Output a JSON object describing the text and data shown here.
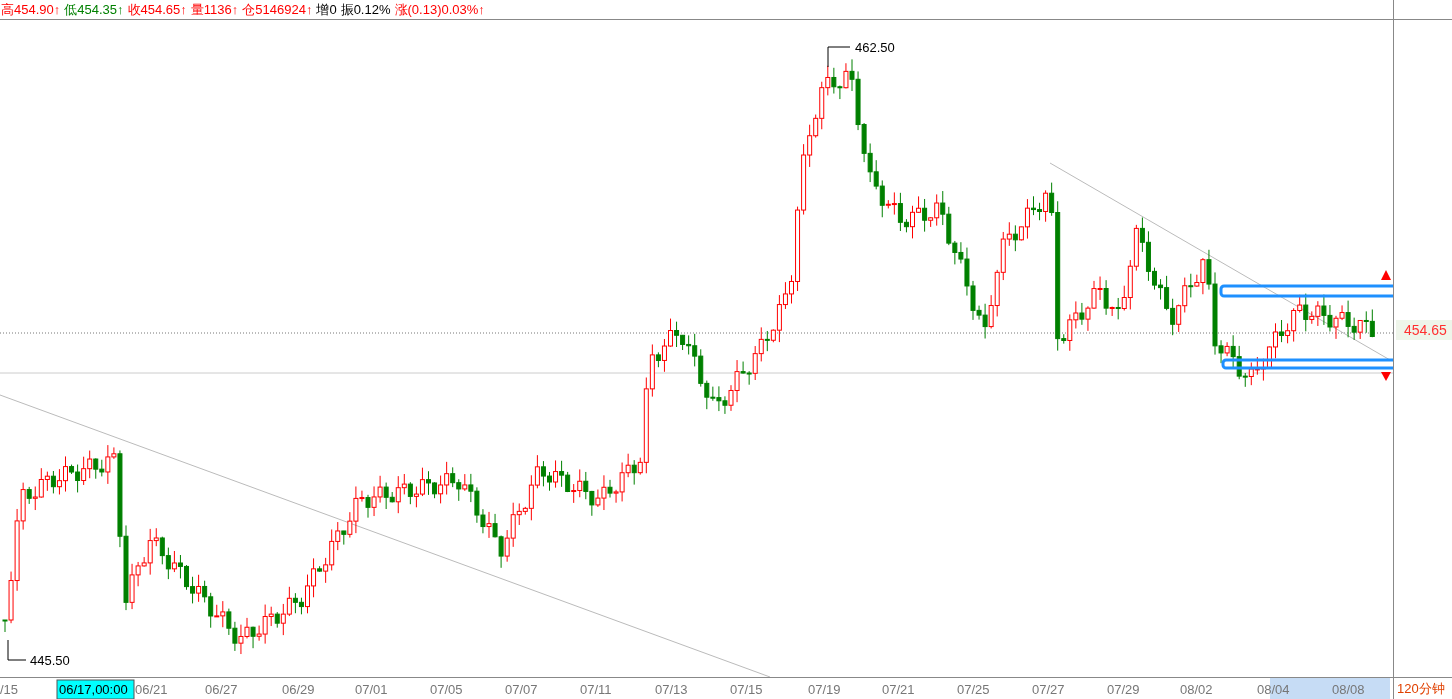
{
  "header": {
    "items": [
      {
        "text": "高454.90↑",
        "color": "#ff0000"
      },
      {
        "text": "低454.35↑",
        "color": "#008000"
      },
      {
        "text": "收454.65↑",
        "color": "#ff0000"
      },
      {
        "text": "量1136↑",
        "color": "#ff0000"
      },
      {
        "text": "仓5146924↑",
        "color": "#ff0000"
      },
      {
        "text": "增0",
        "color": "#000000"
      },
      {
        "text": "振0.12%",
        "color": "#000000"
      },
      {
        "text": "涨(0.13)0.03%↑",
        "color": "#ff0000"
      }
    ]
  },
  "chart": {
    "high_label": "462.50",
    "low_label": "445.50",
    "last_price": "454.65",
    "period": "120分钟"
  },
  "x_axis": {
    "labels": [
      {
        "text": "/15",
        "selected": false
      },
      {
        "text": "06/17,00:00",
        "selected": true
      },
      {
        "text": "06/21",
        "selected": false
      },
      {
        "text": "06/27",
        "selected": false
      },
      {
        "text": "06/29",
        "selected": false
      },
      {
        "text": "07/01",
        "selected": false
      },
      {
        "text": "07/05",
        "selected": false
      },
      {
        "text": "07/07",
        "selected": false
      },
      {
        "text": "07/11",
        "selected": false
      },
      {
        "text": "07/13",
        "selected": false
      },
      {
        "text": "07/15",
        "selected": false
      },
      {
        "text": "07/19",
        "selected": false
      },
      {
        "text": "07/21",
        "selected": false
      },
      {
        "text": "07/25",
        "selected": false
      },
      {
        "text": "07/27",
        "selected": false
      },
      {
        "text": "07/29",
        "selected": false
      },
      {
        "text": "08/02",
        "selected": false
      },
      {
        "text": "08/04",
        "selected": false
      },
      {
        "text": "08/08",
        "selected": false
      }
    ]
  }
}
